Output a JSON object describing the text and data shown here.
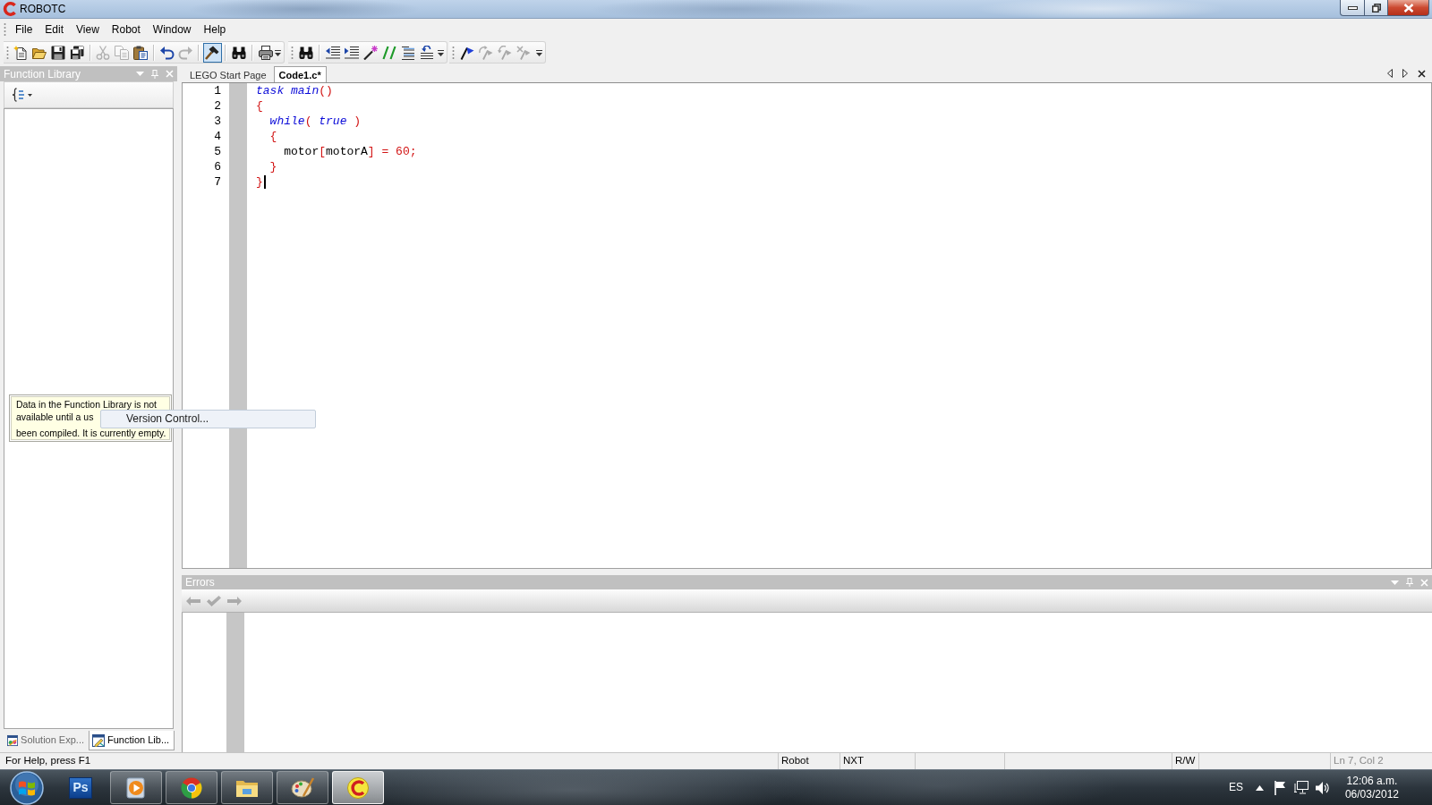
{
  "window": {
    "title": "ROBOTC"
  },
  "menu": [
    "File",
    "Edit",
    "View",
    "Robot",
    "Window",
    "Help"
  ],
  "toolbar": [
    {
      "groups": [
        [
          {
            "kind": "new",
            "disabled": false,
            "pressed": false
          },
          {
            "kind": "open",
            "disabled": false,
            "pressed": false
          },
          {
            "kind": "save",
            "disabled": false,
            "pressed": false
          },
          {
            "kind": "saveall",
            "disabled": false,
            "pressed": false
          }
        ],
        [
          {
            "kind": "cut",
            "disabled": true,
            "pressed": false
          },
          {
            "kind": "copy",
            "disabled": true,
            "pressed": false
          },
          {
            "kind": "paste",
            "disabled": false,
            "pressed": false
          }
        ],
        [
          {
            "kind": "undo",
            "disabled": false,
            "pressed": false
          },
          {
            "kind": "redo",
            "disabled": true,
            "pressed": false
          }
        ],
        [
          {
            "kind": "hammer",
            "disabled": false,
            "pressed": true
          }
        ],
        [
          {
            "kind": "find",
            "disabled": false,
            "pressed": false
          }
        ],
        [
          {
            "kind": "print",
            "disabled": false,
            "pressed": false
          }
        ]
      ]
    },
    {
      "groups": [
        [
          {
            "kind": "find",
            "disabled": false,
            "pressed": false
          }
        ],
        [
          {
            "kind": "outdent",
            "disabled": false,
            "pressed": false
          },
          {
            "kind": "indent",
            "disabled": false,
            "pressed": false
          },
          {
            "kind": "wand",
            "disabled": false,
            "pressed": false
          },
          {
            "kind": "comment",
            "disabled": false,
            "pressed": false
          },
          {
            "kind": "lines",
            "disabled": false,
            "pressed": false
          },
          {
            "kind": "reformat",
            "disabled": false,
            "pressed": false
          }
        ]
      ]
    },
    {
      "groups": [
        [
          {
            "kind": "bookmark",
            "disabled": false,
            "pressed": false
          },
          {
            "kind": "prevmark",
            "disabled": true,
            "pressed": false
          },
          {
            "kind": "nextmark",
            "disabled": true,
            "pressed": false
          },
          {
            "kind": "clearmark",
            "disabled": true,
            "pressed": false
          }
        ]
      ]
    }
  ],
  "function_library": {
    "title": "Function Library",
    "tooltip": [
      "Data in the Function Library is not",
      "available until a us",
      "been compiled. It is currently empty."
    ]
  },
  "popup": {
    "label": "Version Control..."
  },
  "panel_tabs": [
    {
      "kind": "explorer",
      "label": "Solution Exp...",
      "selected": false
    },
    {
      "kind": "library",
      "label": "Function Lib...",
      "selected": true
    }
  ],
  "editor": {
    "tabs": [
      {
        "label": "LEGO Start Page",
        "selected": false
      },
      {
        "label": "Code1.c*",
        "selected": true
      }
    ],
    "lines": [
      {
        "number": "1",
        "cursor": false,
        "tokens": [
          {
            "text": "task main",
            "kind": "keyword"
          },
          {
            "text": "()",
            "kind": "operator"
          }
        ]
      },
      {
        "number": "2",
        "cursor": false,
        "tokens": [
          {
            "text": "{",
            "kind": "operator"
          }
        ]
      },
      {
        "number": "3",
        "cursor": false,
        "tokens": [
          {
            "text": "  while",
            "kind": "keyword"
          },
          {
            "text": "( ",
            "kind": "operator"
          },
          {
            "text": "true",
            "kind": "keyword"
          },
          {
            "text": " )",
            "kind": "operator"
          }
        ]
      },
      {
        "number": "4",
        "cursor": false,
        "tokens": [
          {
            "text": "  {",
            "kind": "operator"
          }
        ]
      },
      {
        "number": "5",
        "cursor": false,
        "tokens": [
          {
            "text": "    motor",
            "kind": "identifier"
          },
          {
            "text": "[",
            "kind": "operator"
          },
          {
            "text": "motorA",
            "kind": "identifier"
          },
          {
            "text": "] = ",
            "kind": "operator"
          },
          {
            "text": "60",
            "kind": "number"
          },
          {
            "text": ";",
            "kind": "operator"
          }
        ]
      },
      {
        "number": "6",
        "cursor": false,
        "tokens": [
          {
            "text": "  }",
            "kind": "operator"
          }
        ]
      },
      {
        "number": "7",
        "cursor": true,
        "tokens": [
          {
            "text": "}",
            "kind": "operator"
          }
        ]
      }
    ]
  },
  "errors": {
    "title": "Errors",
    "tools": [
      {
        "kind": "previous",
        "disabled": true
      },
      {
        "kind": "check",
        "disabled": true
      },
      {
        "kind": "next",
        "disabled": true
      }
    ]
  },
  "status_bar": {
    "help": "For Help, press F1",
    "panes": [
      {
        "text": "Robot",
        "disabled": false
      },
      {
        "text": "NXT",
        "disabled": false
      },
      {
        "text": "R/W",
        "disabled": false
      },
      {
        "text": "Ln 7, Col 2",
        "disabled": true
      }
    ]
  },
  "taskbar": {
    "apps": [
      {
        "kind": "tile",
        "label": "Ps",
        "running": false,
        "selected": false
      },
      {
        "kind": "media",
        "running": true,
        "selected": false
      },
      {
        "kind": "browser",
        "running": true,
        "selected": false
      },
      {
        "kind": "folder",
        "running": true,
        "selected": false
      },
      {
        "kind": "palette",
        "running": true,
        "selected": false
      },
      {
        "kind": "robot",
        "running": true,
        "selected": true
      }
    ],
    "tray": {
      "language": "ES",
      "time": "12:06 a.m.",
      "date": "06/03/2012"
    }
  }
}
